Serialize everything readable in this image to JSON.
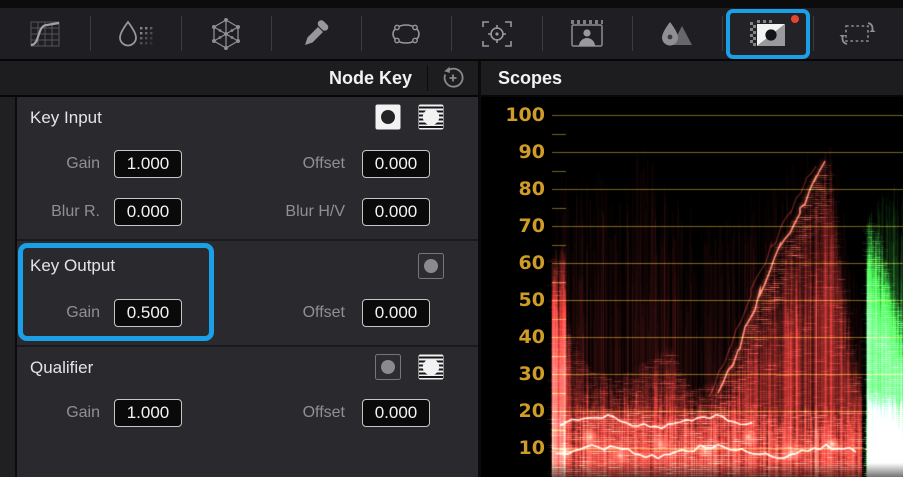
{
  "toolbar": {
    "tools": [
      {
        "name": "custom-curves"
      },
      {
        "name": "color-warper"
      },
      {
        "name": "color-mixer"
      },
      {
        "name": "qualifier-picker"
      },
      {
        "name": "power-window"
      },
      {
        "name": "tracker"
      },
      {
        "name": "magic-mask"
      },
      {
        "name": "blur"
      },
      {
        "name": "key",
        "active": true,
        "notification": true
      },
      {
        "name": "sizing"
      }
    ],
    "active_highlight_color": "#1b9fe6",
    "notification_color": "#e8432f"
  },
  "node_key_panel": {
    "title": "Node Key",
    "key_input": {
      "title": "Key Input",
      "gain_label": "Gain",
      "gain_value": "1.000",
      "offset_label": "Offset",
      "offset_value": "0.000",
      "blur_r_label": "Blur R.",
      "blur_r_value": "0.000",
      "blur_hv_label": "Blur H/V",
      "blur_hv_value": "0.000",
      "toggles": [
        "invert-active",
        "matte-active"
      ]
    },
    "key_output": {
      "title": "Key Output",
      "gain_label": "Gain",
      "gain_value": "0.500",
      "offset_label": "Offset",
      "offset_value": "0.000",
      "highlighted": true,
      "toggles": [
        "invert-inactive"
      ]
    },
    "qualifier": {
      "title": "Qualifier",
      "gain_label": "Gain",
      "gain_value": "1.000",
      "offset_label": "Offset",
      "offset_value": "0.000",
      "toggles": [
        "invert-inactive",
        "matte-active"
      ]
    }
  },
  "scopes_panel": {
    "title": "Scopes",
    "scale_ticks": [
      100,
      90,
      80,
      70,
      60,
      50,
      40,
      30,
      20,
      10
    ],
    "tick_color": "#cf9c28",
    "grid_color": "#75631a",
    "waveform": {
      "type": "waveform",
      "red_color": "225,55,50",
      "green_color": "60,215,70",
      "red": {
        "x_range": [
          552,
          862
        ],
        "faint_top": [
          [
            552,
            70
          ],
          [
            560,
            84
          ],
          [
            575,
            86
          ],
          [
            590,
            82
          ],
          [
            605,
            87
          ],
          [
            615,
            75
          ],
          [
            630,
            90
          ],
          [
            645,
            92
          ],
          [
            660,
            86
          ],
          [
            675,
            80
          ],
          [
            690,
            76
          ],
          [
            705,
            72
          ],
          [
            720,
            70
          ],
          [
            735,
            74
          ],
          [
            750,
            78
          ],
          [
            765,
            80
          ],
          [
            780,
            84
          ],
          [
            795,
            88
          ],
          [
            810,
            91
          ],
          [
            825,
            93
          ],
          [
            838,
            92
          ],
          [
            846,
            70
          ],
          [
            854,
            60
          ],
          [
            862,
            52
          ]
        ],
        "dense_top": [
          [
            552,
            62
          ],
          [
            562,
            58
          ],
          [
            572,
            40
          ],
          [
            582,
            34
          ],
          [
            592,
            31
          ],
          [
            602,
            30
          ],
          [
            615,
            28
          ],
          [
            628,
            30
          ],
          [
            640,
            32
          ],
          [
            652,
            34
          ],
          [
            662,
            37
          ],
          [
            672,
            36
          ],
          [
            682,
            30
          ],
          [
            692,
            27
          ],
          [
            702,
            26
          ],
          [
            712,
            28
          ],
          [
            722,
            30
          ],
          [
            732,
            34
          ],
          [
            742,
            40
          ],
          [
            752,
            46
          ],
          [
            762,
            52
          ],
          [
            772,
            58
          ],
          [
            782,
            64
          ],
          [
            792,
            70
          ],
          [
            802,
            76
          ],
          [
            812,
            82
          ],
          [
            822,
            87
          ],
          [
            830,
            88
          ],
          [
            838,
            70
          ],
          [
            846,
            50
          ],
          [
            854,
            36
          ],
          [
            862,
            28
          ]
        ],
        "ridge": [
          [
            718,
            24
          ],
          [
            740,
            38
          ],
          [
            760,
            52
          ],
          [
            780,
            64
          ],
          [
            800,
            74
          ],
          [
            815,
            82
          ],
          [
            828,
            88
          ]
        ],
        "hot_lines": [
          {
            "x0": 560,
            "x1": 755,
            "v": 17
          },
          {
            "x0": 556,
            "x1": 858,
            "v": 9
          }
        ],
        "hot_spots": [
          [
            566,
            9
          ],
          [
            590,
            13
          ],
          [
            620,
            8
          ],
          [
            660,
            11
          ],
          [
            705,
            9
          ],
          [
            748,
            13
          ],
          [
            792,
            9
          ],
          [
            833,
            11
          ]
        ],
        "base_band_v": 22
      },
      "green": {
        "x_range": [
          867,
          903
        ],
        "faint_top": [
          [
            867,
            72
          ],
          [
            875,
            77
          ],
          [
            885,
            80
          ],
          [
            895,
            82
          ],
          [
            903,
            83
          ]
        ],
        "dense_top": [
          [
            867,
            70
          ],
          [
            872,
            72
          ],
          [
            878,
            68
          ],
          [
            884,
            62
          ],
          [
            890,
            56
          ],
          [
            896,
            50
          ],
          [
            903,
            46
          ]
        ],
        "hot_spots": [
          [
            874,
            11
          ],
          [
            886,
            15
          ],
          [
            896,
            9
          ]
        ],
        "base_band_v": 26
      }
    }
  }
}
